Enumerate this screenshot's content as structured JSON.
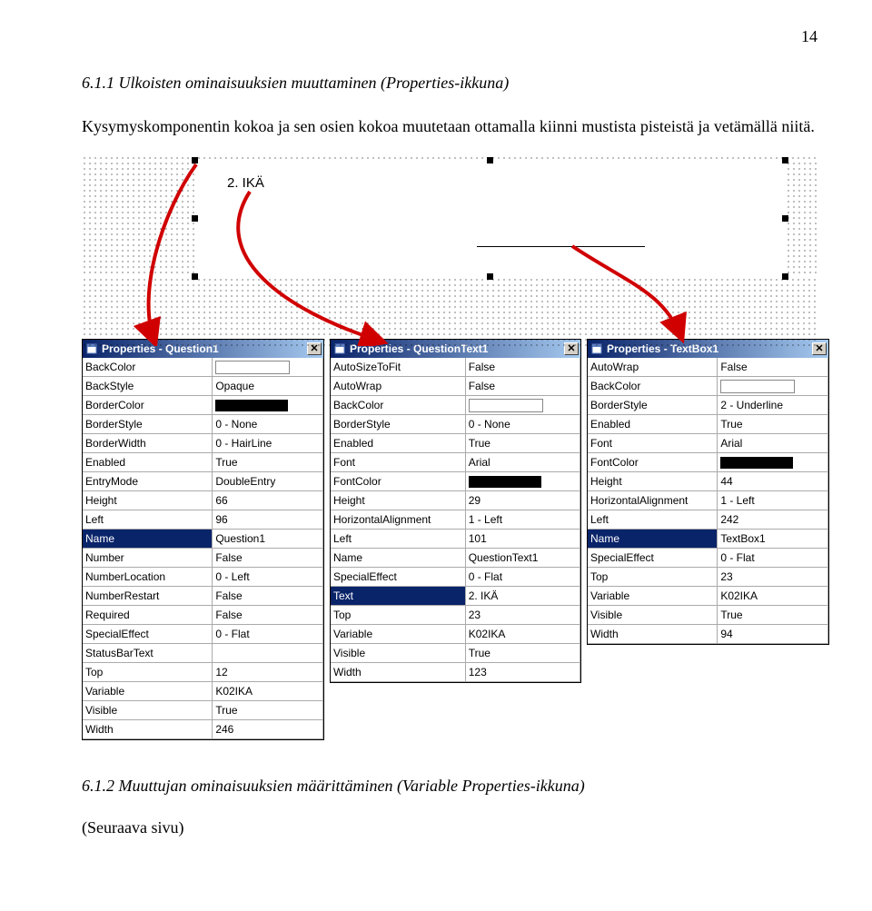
{
  "page_number": "14",
  "section_heading_1": "6.1.1 Ulkoisten ominaisuuksien muuttaminen (Properties-ikkuna)",
  "intro_text": "Kysymyskomponentin kokoa ja sen osien kokoa muutetaan ottamalla kiinni mustista pisteistä ja vetämällä niitä.",
  "designer_question_label": "2. IKÄ",
  "panel1": {
    "title": "Properties - Question1",
    "rows": [
      {
        "k": "BackColor",
        "v": "__swatch_white"
      },
      {
        "k": "BackStyle",
        "v": "Opaque"
      },
      {
        "k": "BorderColor",
        "v": "__swatch_black"
      },
      {
        "k": "BorderStyle",
        "v": "0 - None"
      },
      {
        "k": "BorderWidth",
        "v": "0 - HairLine"
      },
      {
        "k": "Enabled",
        "v": "True"
      },
      {
        "k": "EntryMode",
        "v": "DoubleEntry"
      },
      {
        "k": "Height",
        "v": "66"
      },
      {
        "k": "Left",
        "v": "96"
      },
      {
        "k": "Name",
        "v": "Question1",
        "sel": true
      },
      {
        "k": "Number",
        "v": "False"
      },
      {
        "k": "NumberLocation",
        "v": "0 - Left"
      },
      {
        "k": "NumberRestart",
        "v": "False"
      },
      {
        "k": "Required",
        "v": "False"
      },
      {
        "k": "SpecialEffect",
        "v": "0 - Flat"
      },
      {
        "k": "StatusBarText",
        "v": ""
      },
      {
        "k": "Top",
        "v": "12"
      },
      {
        "k": "Variable",
        "v": "K02IKA"
      },
      {
        "k": "Visible",
        "v": "True"
      },
      {
        "k": "Width",
        "v": "246"
      }
    ]
  },
  "panel2": {
    "title": "Properties - QuestionText1",
    "rows": [
      {
        "k": "AutoSizeToFit",
        "v": "False"
      },
      {
        "k": "AutoWrap",
        "v": "False"
      },
      {
        "k": "BackColor",
        "v": "__swatch_white"
      },
      {
        "k": "BorderStyle",
        "v": "0 - None"
      },
      {
        "k": "Enabled",
        "v": "True"
      },
      {
        "k": "Font",
        "v": "Arial"
      },
      {
        "k": "FontColor",
        "v": "__swatch_black"
      },
      {
        "k": "Height",
        "v": "29"
      },
      {
        "k": "HorizontalAlignment",
        "v": "1 - Left"
      },
      {
        "k": "Left",
        "v": "101"
      },
      {
        "k": "Name",
        "v": "QuestionText1"
      },
      {
        "k": "SpecialEffect",
        "v": "0 - Flat"
      },
      {
        "k": "Text",
        "v": "2. IKÄ",
        "sel": true
      },
      {
        "k": "Top",
        "v": "23"
      },
      {
        "k": "Variable",
        "v": "K02IKA"
      },
      {
        "k": "Visible",
        "v": "True"
      },
      {
        "k": "Width",
        "v": "123"
      }
    ]
  },
  "panel3": {
    "title": "Properties - TextBox1",
    "rows": [
      {
        "k": "AutoWrap",
        "v": "False"
      },
      {
        "k": "BackColor",
        "v": "__swatch_white"
      },
      {
        "k": "BorderStyle",
        "v": "2 - Underline"
      },
      {
        "k": "Enabled",
        "v": "True"
      },
      {
        "k": "Font",
        "v": "Arial"
      },
      {
        "k": "FontColor",
        "v": "__swatch_black"
      },
      {
        "k": "Height",
        "v": "44"
      },
      {
        "k": "HorizontalAlignment",
        "v": "1 - Left"
      },
      {
        "k": "Left",
        "v": "242"
      },
      {
        "k": "Name",
        "v": "TextBox1",
        "sel": true
      },
      {
        "k": "SpecialEffect",
        "v": "0 - Flat"
      },
      {
        "k": "Top",
        "v": "23"
      },
      {
        "k": "Variable",
        "v": "K02IKA"
      },
      {
        "k": "Visible",
        "v": "True"
      },
      {
        "k": "Width",
        "v": "94"
      }
    ]
  },
  "section_heading_2": "6.1.2 Muuttujan ominaisuuksien määrittäminen (Variable Properties-ikkuna)",
  "next_page_note": "(Seuraava sivu)"
}
